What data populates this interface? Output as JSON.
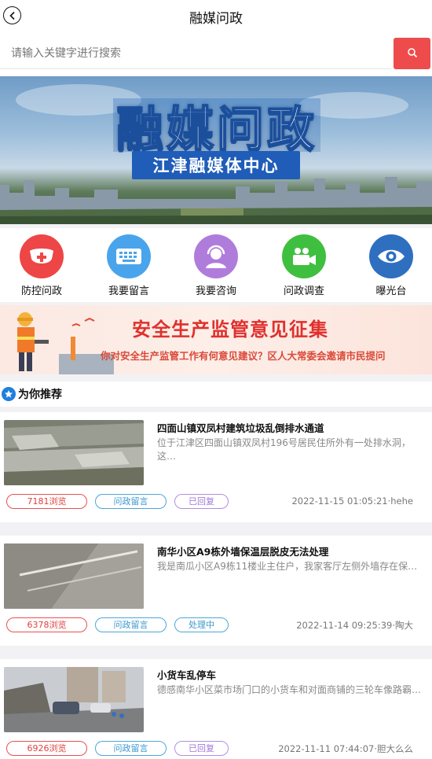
{
  "header": {
    "title": "融媒问政",
    "back_icon": "chevron-left-icon"
  },
  "search": {
    "placeholder": "请输入关键字进行搜索",
    "button_icon": "search-icon",
    "button_color": "#ee4c4c"
  },
  "banner": {
    "title": "融媒问政",
    "subtitle": "江津融媒体中心"
  },
  "nav": {
    "items": [
      {
        "label": "防控问政",
        "icon": "mask-icon",
        "color": "#ee4646"
      },
      {
        "label": "我要留言",
        "icon": "keyboard-icon",
        "color": "#4aa4ec"
      },
      {
        "label": "我要咨询",
        "icon": "headset-user-icon",
        "color": "#b07cdc"
      },
      {
        "label": "问政调查",
        "icon": "video-camera-icon",
        "color": "#3fbf3f"
      },
      {
        "label": "曝光台",
        "icon": "eye-icon",
        "color": "#2e6fc0"
      }
    ]
  },
  "promo": {
    "title": "安全生产监管意见征集",
    "subtitle": "你对安全生产监管工作有何意见建议？区人大常委会邀请市民提问"
  },
  "recommend": {
    "label": "为你推荐",
    "icon": "star-badge-icon"
  },
  "cards": [
    {
      "title": "四面山镇双凤村建筑垃圾乱倒排水通道",
      "summary": "位于江津区四面山镇双凤村196号居民住所外有一处排水洞，这…",
      "views": "7181浏览",
      "type": "问政留言",
      "status": "已回复",
      "meta": "2022-11-15 01:05:21·hehe"
    },
    {
      "title": "南华小区A9栋外墙保温层脱皮无法处理",
      "summary": "我是南瓜小区A9栋11楼业主住户，我家客厅左侧外墙存在保温…",
      "views": "6378浏览",
      "type": "问政留言",
      "status": "处理中",
      "meta": "2022-11-14 09:25:39·陶大"
    },
    {
      "title": "小货车乱停车",
      "summary": "德感南华小区菜市场门口的小货车和对面商铺的三轮车像路霸…",
      "views": "6926浏览",
      "type": "问政留言",
      "status": "已回复",
      "meta": "2022-11-11 07:44:07·胆大么么"
    }
  ]
}
